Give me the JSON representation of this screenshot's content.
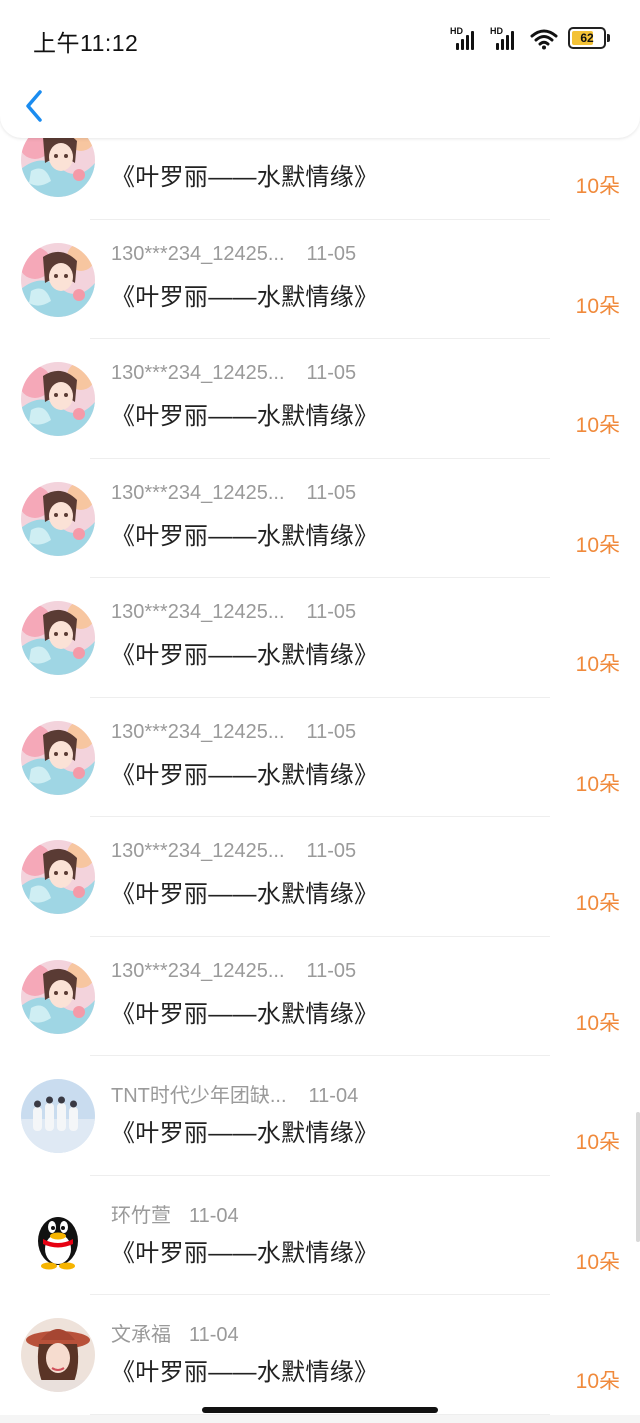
{
  "status_bar": {
    "time": "上午11:12",
    "battery": "62",
    "signal_label": "HD"
  },
  "rows": [
    {
      "avatar": "anime-girl",
      "user": "",
      "date": "",
      "title": "《叶罗丽——水默情缘》",
      "amount": "10朵"
    },
    {
      "avatar": "anime-girl",
      "user": "130***234_12425...",
      "date": "11-05",
      "title": "《叶罗丽——水默情缘》",
      "amount": "10朵"
    },
    {
      "avatar": "anime-girl",
      "user": "130***234_12425...",
      "date": "11-05",
      "title": "《叶罗丽——水默情缘》",
      "amount": "10朵"
    },
    {
      "avatar": "anime-girl",
      "user": "130***234_12425...",
      "date": "11-05",
      "title": "《叶罗丽——水默情缘》",
      "amount": "10朵"
    },
    {
      "avatar": "anime-girl",
      "user": "130***234_12425...",
      "date": "11-05",
      "title": "《叶罗丽——水默情缘》",
      "amount": "10朵"
    },
    {
      "avatar": "anime-girl",
      "user": "130***234_12425...",
      "date": "11-05",
      "title": "《叶罗丽——水默情缘》",
      "amount": "10朵"
    },
    {
      "avatar": "anime-girl",
      "user": "130***234_12425...",
      "date": "11-05",
      "title": "《叶罗丽——水默情缘》",
      "amount": "10朵"
    },
    {
      "avatar": "anime-girl",
      "user": "130***234_12425...",
      "date": "11-05",
      "title": "《叶罗丽——水默情缘》",
      "amount": "10朵"
    },
    {
      "avatar": "band-photo",
      "user": "TNT时代少年团缺...",
      "date": "11-04",
      "title": "《叶罗丽——水默情缘》",
      "amount": "10朵"
    },
    {
      "avatar": "qq-penguin",
      "user": "环竹萱",
      "date": "11-04",
      "title": "《叶罗丽——水默情缘》",
      "amount": "10朵"
    },
    {
      "avatar": "woman-hat",
      "user": "文承福",
      "date": "11-04",
      "title": "《叶罗丽——水默情缘》",
      "amount": "10朵"
    }
  ],
  "colors": {
    "amount": "#f08a3c",
    "accent": "#1a8cf0",
    "meta": "#9a9a9a"
  }
}
